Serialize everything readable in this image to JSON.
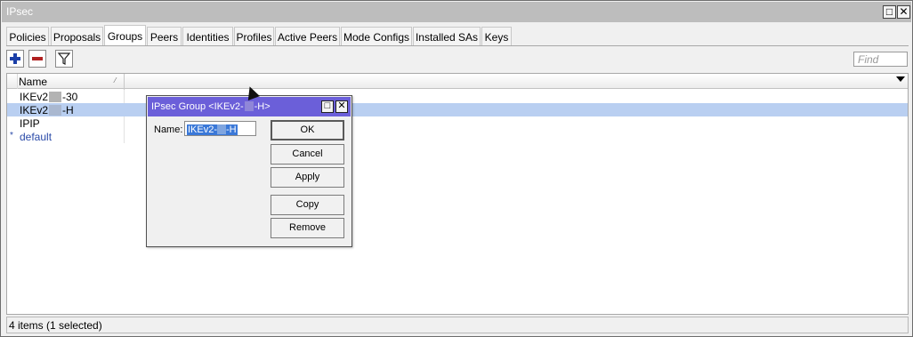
{
  "window": {
    "title": "IPsec",
    "restore_icon": "restore-icon",
    "close_icon": "close-icon"
  },
  "tabs": [
    {
      "label": "Policies"
    },
    {
      "label": "Proposals"
    },
    {
      "label": "Groups"
    },
    {
      "label": "Peers"
    },
    {
      "label": "Identities"
    },
    {
      "label": "Profiles"
    },
    {
      "label": "Active Peers"
    },
    {
      "label": "Mode Configs"
    },
    {
      "label": "Installed SAs"
    },
    {
      "label": "Keys"
    }
  ],
  "active_tab": "Groups",
  "toolbar": {
    "add_icon": "plus-icon",
    "remove_icon": "minus-icon",
    "filter_icon": "filter-icon"
  },
  "search": {
    "placeholder": "Find",
    "value": ""
  },
  "table": {
    "columns": [
      {
        "label": "Name"
      }
    ],
    "rows": [
      {
        "prefix": "IKEv2",
        "suffix": "-30",
        "flag": "",
        "selected": false
      },
      {
        "prefix": "IKEv2",
        "suffix": "-H",
        "flag": "",
        "selected": true
      },
      {
        "prefix": "IPIP",
        "suffix": "",
        "flag": "",
        "selected": false
      },
      {
        "prefix": "default",
        "suffix": "",
        "flag": "*",
        "selected": false
      }
    ]
  },
  "status": {
    "text": "4 items (1 selected)"
  },
  "dialog": {
    "title_prefix": "IPsec Group <IKEv2-",
    "title_suffix": "-H>",
    "name_label": "Name:",
    "name_value_prefix": "IKEv2-",
    "name_value_suffix": "-H",
    "buttons": {
      "ok": "OK",
      "cancel": "Cancel",
      "apply": "Apply",
      "copy": "Copy",
      "remove": "Remove"
    }
  },
  "colors": {
    "dialog_title": "#6b5fd9",
    "selection": "#b9cff1",
    "add_icon": "#1b3fa8",
    "remove_icon": "#b02020"
  }
}
